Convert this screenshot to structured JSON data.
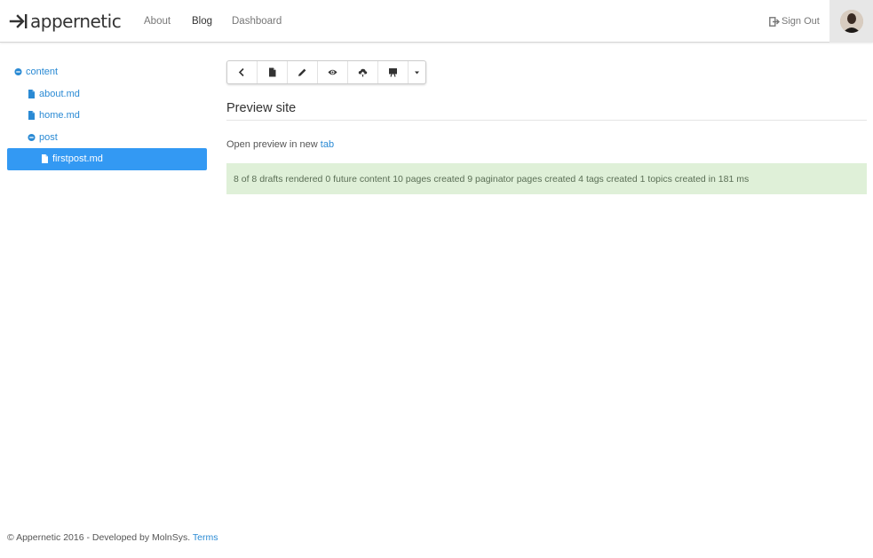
{
  "brand": {
    "name": "appernetic"
  },
  "nav": {
    "about": "About",
    "blog": "Blog",
    "dashboard": "Dashboard",
    "signout": "Sign Out"
  },
  "tree": {
    "root": "content",
    "items": [
      {
        "label": "about.md",
        "type": "file"
      },
      {
        "label": "home.md",
        "type": "file"
      },
      {
        "label": "post",
        "type": "folder"
      },
      {
        "label": "firstpost.md",
        "type": "file",
        "selected": true
      }
    ]
  },
  "toolbar": {
    "icons": [
      "chevron-left-icon",
      "file-icon",
      "pencil-icon",
      "eye-icon",
      "cloud-upload-icon",
      "blackboard-icon",
      "caret-down-icon"
    ]
  },
  "main": {
    "title": "Preview site",
    "preview_text": "Open preview in new",
    "preview_link": "tab",
    "status": "8 of 8 drafts rendered 0 future content 10 pages created 9 paginator pages created 4 tags created 1 topics created in 181 ms"
  },
  "footer": {
    "text": "© Appernetic 2016 - Developed by MolnSys.",
    "link": "Terms"
  },
  "colors": {
    "link": "#2a8ad4",
    "selected": "#3399f3",
    "alert_bg": "#dff0d8"
  }
}
